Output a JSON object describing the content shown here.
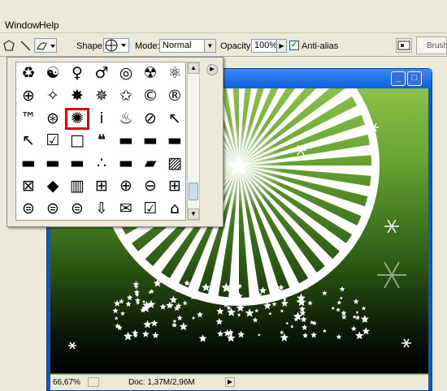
{
  "menubar": {
    "items": [
      "Window",
      "Help"
    ]
  },
  "options": {
    "shape_label": "Shape:",
    "mode_label": "Mode:",
    "mode_value": "Normal",
    "opacity_label": "Opacity:",
    "opacity_value": "100%",
    "antialias_label": "Anti-alias",
    "antialias_checked": true,
    "brushes_tab": "Brushes"
  },
  "shape_picker": {
    "rows": [
      [
        "♻",
        "☯",
        "♀",
        "♂",
        "◎",
        "☢",
        "⚛"
      ],
      [
        "⊕",
        "✧",
        "✸",
        "✵",
        "✩",
        "©",
        "®"
      ],
      [
        "™",
        "⊛",
        "✺",
        "i",
        "♨",
        "⊘",
        "↖"
      ],
      [
        "↖",
        "☑",
        "□",
        "❝",
        "▬",
        "▬",
        "▬"
      ],
      [
        "▬",
        "▬",
        "▬",
        "∴",
        "▬",
        "▰",
        "▨"
      ],
      [
        "⊠",
        "◆",
        "▥",
        "⊞",
        "⊕",
        "⊖",
        "⊞"
      ],
      [
        "⊜",
        "⊜",
        "⊜",
        "⇩",
        "✉",
        "☑",
        "⌂"
      ]
    ],
    "selected": {
      "row": 2,
      "col": 2
    }
  },
  "document": {
    "window_controls": [
      "_",
      "□",
      "×"
    ]
  },
  "status": {
    "zoom": "66,67%",
    "doc": "Doc: 1,37M/2,96M"
  }
}
